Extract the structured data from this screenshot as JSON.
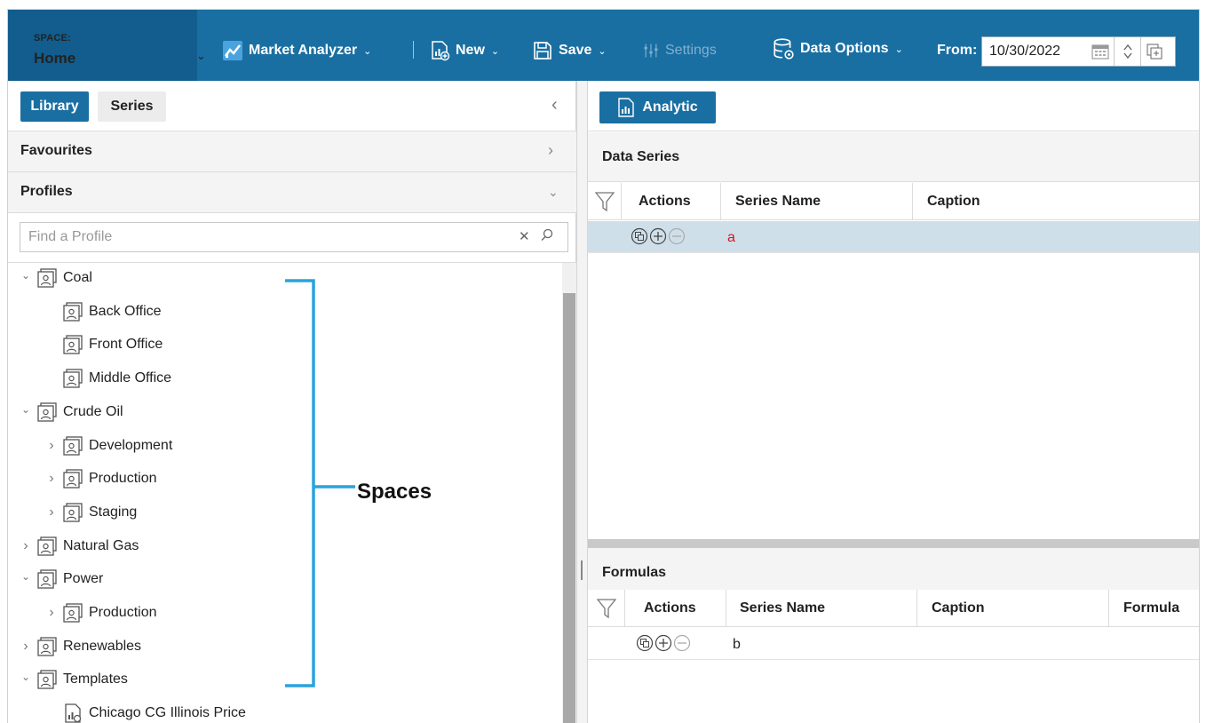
{
  "toolbar": {
    "space_caption": "SPACE:",
    "space_value": "Home",
    "market_analyzer": "Market Analyzer",
    "new": "New",
    "save": "Save",
    "settings": "Settings",
    "data_options": "Data Options",
    "from_label": "From:",
    "from_date": "10/30/2022"
  },
  "left_panel": {
    "tabs": {
      "library": "Library",
      "series": "Series"
    },
    "favourites": "Favourites",
    "profiles": "Profiles",
    "search_placeholder": "Find a Profile",
    "tree": [
      {
        "label": "Coal",
        "expanded": true,
        "level": 0,
        "icon": "profile-folder-icon"
      },
      {
        "label": "Back Office",
        "level": 1,
        "icon": "profile-folder-icon"
      },
      {
        "label": "Front Office",
        "level": 1,
        "icon": "profile-folder-icon"
      },
      {
        "label": "Middle Office",
        "level": 1,
        "icon": "profile-folder-icon"
      },
      {
        "label": "Crude Oil",
        "expanded": true,
        "level": 0,
        "icon": "profile-folder-icon"
      },
      {
        "label": "Development",
        "expanded": false,
        "level": 1,
        "icon": "profile-folder-icon"
      },
      {
        "label": "Production",
        "expanded": false,
        "level": 1,
        "icon": "profile-folder-icon"
      },
      {
        "label": "Staging",
        "expanded": false,
        "level": 1,
        "icon": "profile-folder-icon"
      },
      {
        "label": "Natural Gas",
        "expanded": false,
        "level": 0,
        "icon": "profile-folder-icon"
      },
      {
        "label": "Power",
        "expanded": true,
        "level": 0,
        "icon": "profile-folder-icon"
      },
      {
        "label": "Production",
        "expanded": false,
        "level": 1,
        "icon": "profile-folder-icon"
      },
      {
        "label": "Renewables",
        "expanded": false,
        "level": 0,
        "icon": "profile-folder-icon"
      },
      {
        "label": "Templates",
        "expanded": true,
        "level": 0,
        "icon": "profile-folder-icon"
      },
      {
        "label": "Chicago CG Illinois Price",
        "level": 1,
        "icon": "analytic-chart-icon"
      }
    ],
    "annotation": "Spaces"
  },
  "right_panel": {
    "analytic_button": "Analytic",
    "data_series": {
      "title": "Data Series",
      "columns": [
        "Actions",
        "Series Name",
        "Caption"
      ],
      "rows": [
        {
          "series_name": "a",
          "caption": ""
        }
      ]
    },
    "formulas": {
      "title": "Formulas",
      "columns": [
        "Actions",
        "Series Name",
        "Caption",
        "Formula"
      ],
      "rows": [
        {
          "series_name": "b",
          "caption": "",
          "formula": ""
        }
      ]
    }
  },
  "colors": {
    "toolbar_bg": "#1a6fa2",
    "space_bg": "#125d8d",
    "accent": "#1a6fa2",
    "selected_row": "#cfdfea",
    "annotation_bracket": "#29a3dd",
    "series_name_red": "#d01818"
  }
}
